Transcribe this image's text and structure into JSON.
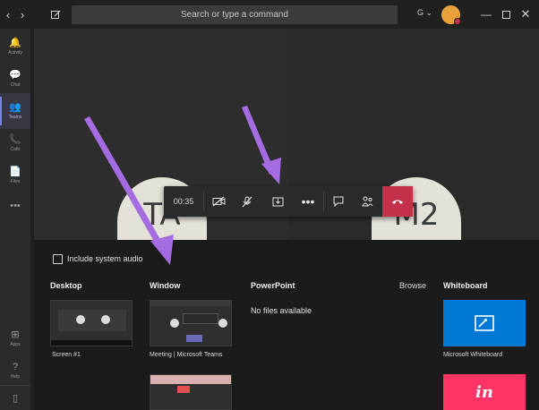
{
  "search": {
    "placeholder": "Search or type a command"
  },
  "account": {
    "initial": "G",
    "caret": "⌄"
  },
  "rail": {
    "items": [
      {
        "label": "Activity",
        "icon": "🔔"
      },
      {
        "label": "Chat",
        "icon": "💬"
      },
      {
        "label": "Teams",
        "icon": "👥"
      },
      {
        "label": "Calls",
        "icon": "📞"
      },
      {
        "label": "Files",
        "icon": "📄"
      },
      {
        "label": "",
        "icon": "•••"
      },
      {
        "label": "Apps",
        "icon": "⊞"
      },
      {
        "label": "Help",
        "icon": "?"
      }
    ]
  },
  "participants": [
    {
      "initials": "TA"
    },
    {
      "initials": "M2"
    }
  ],
  "controls": {
    "timer": "00:35"
  },
  "share": {
    "include_audio": "Include system audio",
    "sections": {
      "desktop": "Desktop",
      "window": "Window",
      "powerpoint": "PowerPoint",
      "browse": "Browse",
      "whiteboard": "Whiteboard"
    },
    "desktop_items": [
      "Screen #1"
    ],
    "window_items": [
      "Meeting | Microsoft Teams"
    ],
    "powerpoint_empty": "No files available",
    "whiteboard_items": [
      "Microsoft Whiteboard"
    ],
    "invision_logo": "in"
  },
  "colors": {
    "accent": "#7b83eb",
    "hangup": "#c4314b",
    "whiteboard": "#0078d4",
    "invision": "#ff3366",
    "arrow": "#a46ce0"
  }
}
